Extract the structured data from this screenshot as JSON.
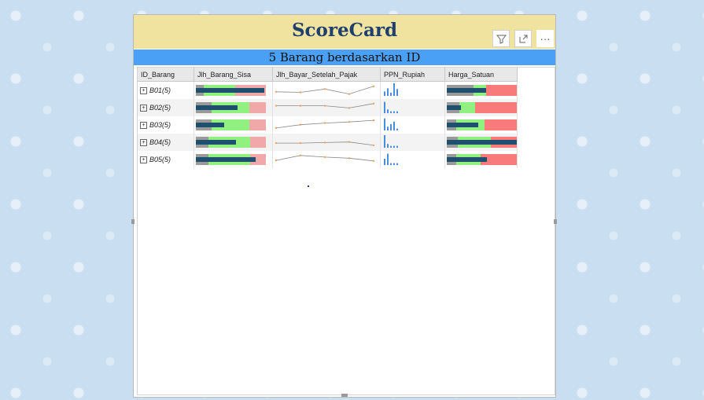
{
  "card": {
    "title": "ScoreCard",
    "subtitle": "5 Barang berdasarkan ID"
  },
  "toolbar": {
    "icons": [
      "filter-icon",
      "focus-mode-icon",
      "more-options-icon"
    ],
    "more_label": "···"
  },
  "table": {
    "columns": [
      "ID_Barang",
      "Jlh_Barang_Sisa",
      "Jlh_Bayar_Setelah_Pajak",
      "PPN_Rupiah",
      "Harga_Satuan"
    ],
    "rows": [
      {
        "id": "B01(5)",
        "sisa": [
          0.98,
          0.7,
          0.35,
          0.2,
          0.03
        ],
        "bayar": [
          0.3,
          0.25,
          0.55,
          0.1,
          0.8
        ],
        "ppn": [
          0.35,
          0.6,
          0.25,
          1.0,
          0.55
        ],
        "harga": [
          0.56,
          0.7,
          0.35,
          0.12,
          0.3
        ]
      },
      {
        "id": "B02(5)",
        "sisa": [
          0.6,
          0.95,
          0.45,
          0.4,
          0.15
        ],
        "bayar": [
          0.6,
          0.6,
          0.6,
          0.4,
          0.8
        ],
        "ppn": [
          0.9,
          0.3,
          0.15,
          0.15,
          0.15
        ],
        "harga": [
          0.2,
          0.5,
          0.15,
          0.3,
          0.1
        ]
      },
      {
        "id": "B03(5)",
        "sisa": [
          0.4,
          0.95,
          0.45,
          0.4,
          0.15
        ],
        "bayar": [
          0.15,
          0.45,
          0.6,
          0.7,
          0.85
        ],
        "ppn": [
          0.95,
          0.3,
          0.5,
          0.7,
          0.15
        ],
        "harga": [
          0.45,
          0.67,
          0.2,
          0.1,
          0.05
        ]
      },
      {
        "id": "B04(5)",
        "sisa": [
          0.57,
          0.97,
          0.45,
          0.3,
          0.1
        ],
        "bayar": [
          0.35,
          0.35,
          0.4,
          0.45,
          0.15
        ],
        "ppn": [
          1.0,
          0.3,
          0.15,
          0.15,
          0.15
        ],
        "harga": [
          1.0,
          0.78,
          0.15,
          0.1,
          0.08
        ]
      },
      {
        "id": "B05(5)",
        "sisa": [
          0.85,
          0.97,
          0.55,
          0.45,
          0.1
        ],
        "bayar": [
          0.35,
          0.8,
          0.65,
          0.55,
          0.3
        ],
        "ppn": [
          0.5,
          0.9,
          0.15,
          0.15,
          0.15
        ],
        "harga": [
          0.57,
          0.6,
          0.2,
          0.12,
          0.05
        ]
      }
    ]
  },
  "colors": {
    "bar_actual": "#1e4f6e",
    "band_good": "#90f080",
    "band_bad": "#f0a8a8",
    "band_low": "#9a9a9a",
    "band_bad_harga": "#f87a7a",
    "line": "#888888",
    "marker": "#f0a060",
    "ppn_bar": "#4a8fdc"
  }
}
